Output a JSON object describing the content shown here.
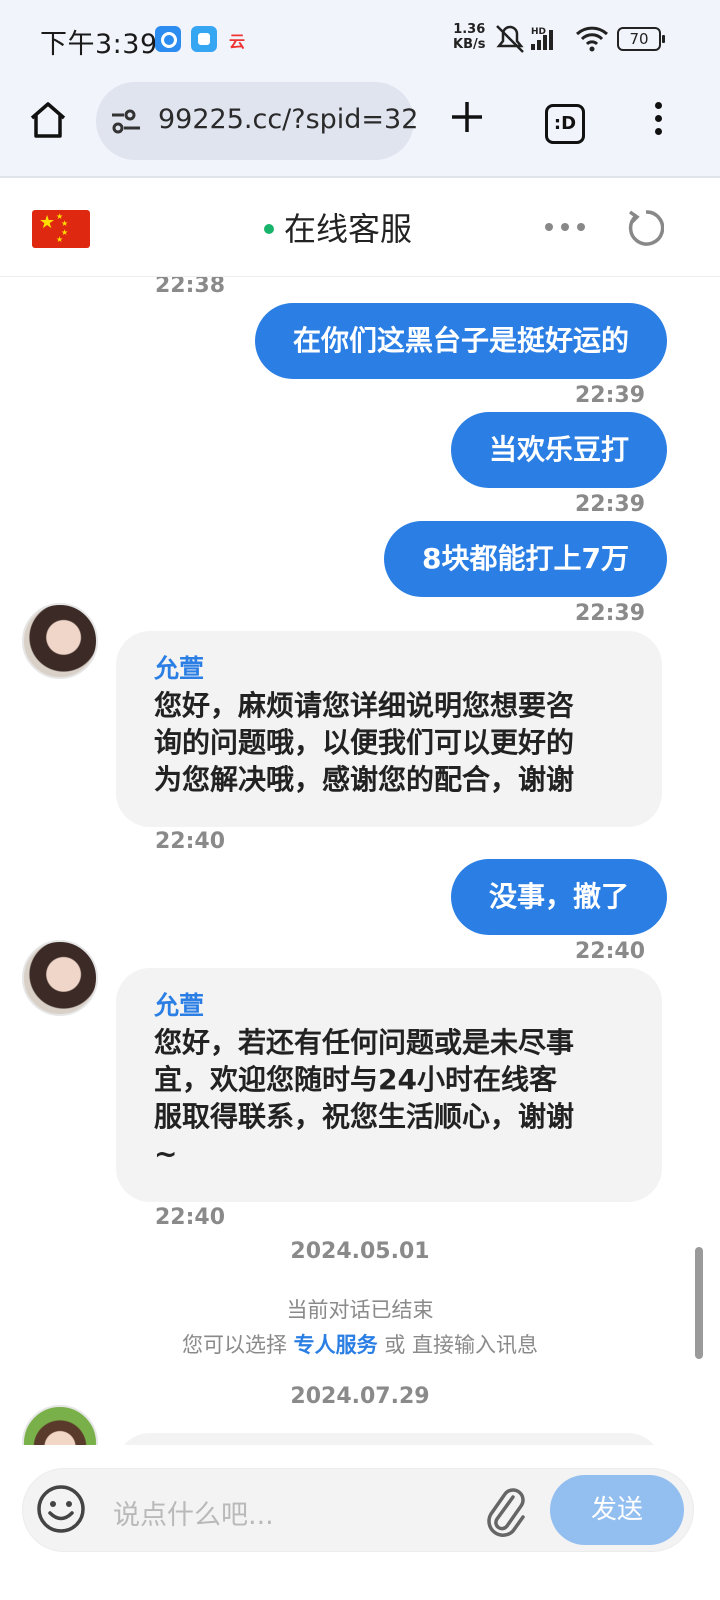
{
  "status_bar": {
    "time": "下午3:39",
    "network_speed_value": "1.36",
    "network_speed_unit": "KB/s",
    "battery": "70",
    "icons": [
      "clock-app-icon",
      "assistant-app-icon",
      "cloud-app-icon",
      "mute-icon",
      "hd-signal-icon",
      "wifi-icon",
      "battery-icon"
    ]
  },
  "browser": {
    "url": "99225.cc/?spid=32",
    "tabs_label": ":D"
  },
  "chat_header": {
    "title": "在线客服",
    "status_color": "#19b46c"
  },
  "messages": [
    {
      "type": "time",
      "text": "22:38"
    },
    {
      "type": "out",
      "text": "在你们这黑台子是挺好运的",
      "time": "22:39"
    },
    {
      "type": "out",
      "text": "当欢乐豆打",
      "time": "22:39"
    },
    {
      "type": "out",
      "text": "8块都能打上7万",
      "time": "22:39"
    },
    {
      "type": "in",
      "sender": "允萱",
      "lines": [
        "您好，麻烦请您详细说明您想要咨",
        "询的问题哦，以便我们可以更好的",
        "为您解决哦，感谢您的配合，谢谢"
      ],
      "time": "22:40"
    },
    {
      "type": "out",
      "text": "没事，撤了",
      "time": "22:40"
    },
    {
      "type": "in",
      "sender": "允萱",
      "lines": [
        "您好，若还有任何问题或是未尽事",
        "宜，欢迎您随时与24小时在线客",
        "服取得联系，祝您生活顺心，谢谢",
        "~"
      ],
      "time": "22:40"
    }
  ],
  "date_separators": [
    "2024.05.01",
    "2024.07.29"
  ],
  "session_ended": {
    "line1": "当前对话已结束",
    "prefix": "您可以选择",
    "link": "专人服务",
    "middle": "或",
    "suffix": "直接输入讯息"
  },
  "input": {
    "placeholder": "说点什么吧...",
    "send_label": "发送"
  },
  "colors": {
    "accent": "#2b7fe4",
    "send_disabled": "#93bff0",
    "bubble_in": "#f3f3f3"
  }
}
